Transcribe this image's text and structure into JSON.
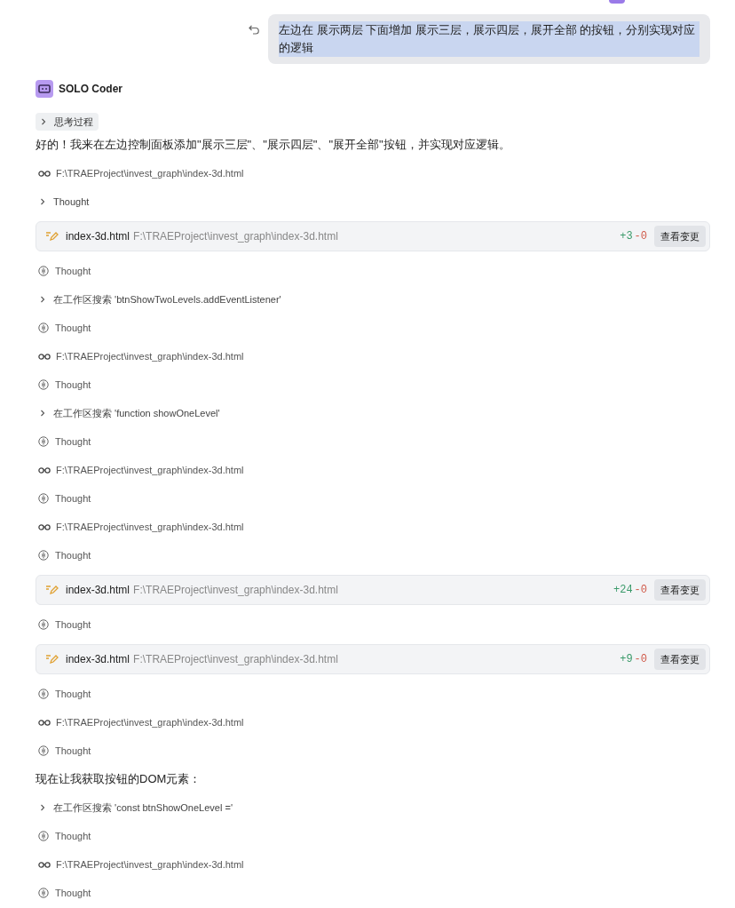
{
  "user_message": {
    "text": "左边在 展示两层 下面增加 展示三层，展示四层，展开全部 的按钮，分别实现对应的逻辑",
    "selected": true
  },
  "agent": {
    "name": "SOLO Coder"
  },
  "thinking_chip": {
    "label": "思考过程",
    "expanded": false
  },
  "steps": [
    {
      "kind": "text",
      "text": "好的！我来在左边控制面板添加\"展示三层\"、\"展示四层\"、\"展开全部\"按钮，并实现对应逻辑。"
    },
    {
      "kind": "read",
      "text": "F:\\TRAEProject\\invest_graph\\index-3d.html"
    },
    {
      "kind": "collapsed",
      "text": "Thought"
    },
    {
      "kind": "edit",
      "file": "index-3d.html",
      "path": "F:\\TRAEProject\\invest_graph\\index-3d.html",
      "added": "+3",
      "removed": "-0",
      "button": "查看变更"
    },
    {
      "kind": "thought",
      "text": "Thought"
    },
    {
      "kind": "collapsed",
      "text": "在工作区搜索 'btnShowTwoLevels.addEventListener'"
    },
    {
      "kind": "thought",
      "text": "Thought"
    },
    {
      "kind": "read",
      "text": "F:\\TRAEProject\\invest_graph\\index-3d.html"
    },
    {
      "kind": "thought",
      "text": "Thought"
    },
    {
      "kind": "collapsed",
      "text": "在工作区搜索 'function showOneLevel'"
    },
    {
      "kind": "thought",
      "text": "Thought"
    },
    {
      "kind": "read",
      "text": "F:\\TRAEProject\\invest_graph\\index-3d.html"
    },
    {
      "kind": "thought",
      "text": "Thought"
    },
    {
      "kind": "read",
      "text": "F:\\TRAEProject\\invest_graph\\index-3d.html"
    },
    {
      "kind": "thought",
      "text": "Thought"
    },
    {
      "kind": "edit",
      "file": "index-3d.html",
      "path": "F:\\TRAEProject\\invest_graph\\index-3d.html",
      "added": "+24",
      "removed": "-0",
      "button": "查看变更"
    },
    {
      "kind": "thought",
      "text": "Thought"
    },
    {
      "kind": "edit",
      "file": "index-3d.html",
      "path": "F:\\TRAEProject\\invest_graph\\index-3d.html",
      "added": "+9",
      "removed": "-0",
      "button": "查看变更"
    },
    {
      "kind": "thought",
      "text": "Thought"
    },
    {
      "kind": "read",
      "text": "F:\\TRAEProject\\invest_graph\\index-3d.html"
    },
    {
      "kind": "thought",
      "text": "Thought"
    },
    {
      "kind": "text",
      "text": "现在让我获取按钮的DOM元素："
    },
    {
      "kind": "collapsed",
      "text": "在工作区搜索 'const btnShowOneLevel ='"
    },
    {
      "kind": "thought",
      "text": "Thought"
    },
    {
      "kind": "read",
      "text": "F:\\TRAEProject\\invest_graph\\index-3d.html"
    },
    {
      "kind": "thought",
      "text": "Thought"
    }
  ]
}
